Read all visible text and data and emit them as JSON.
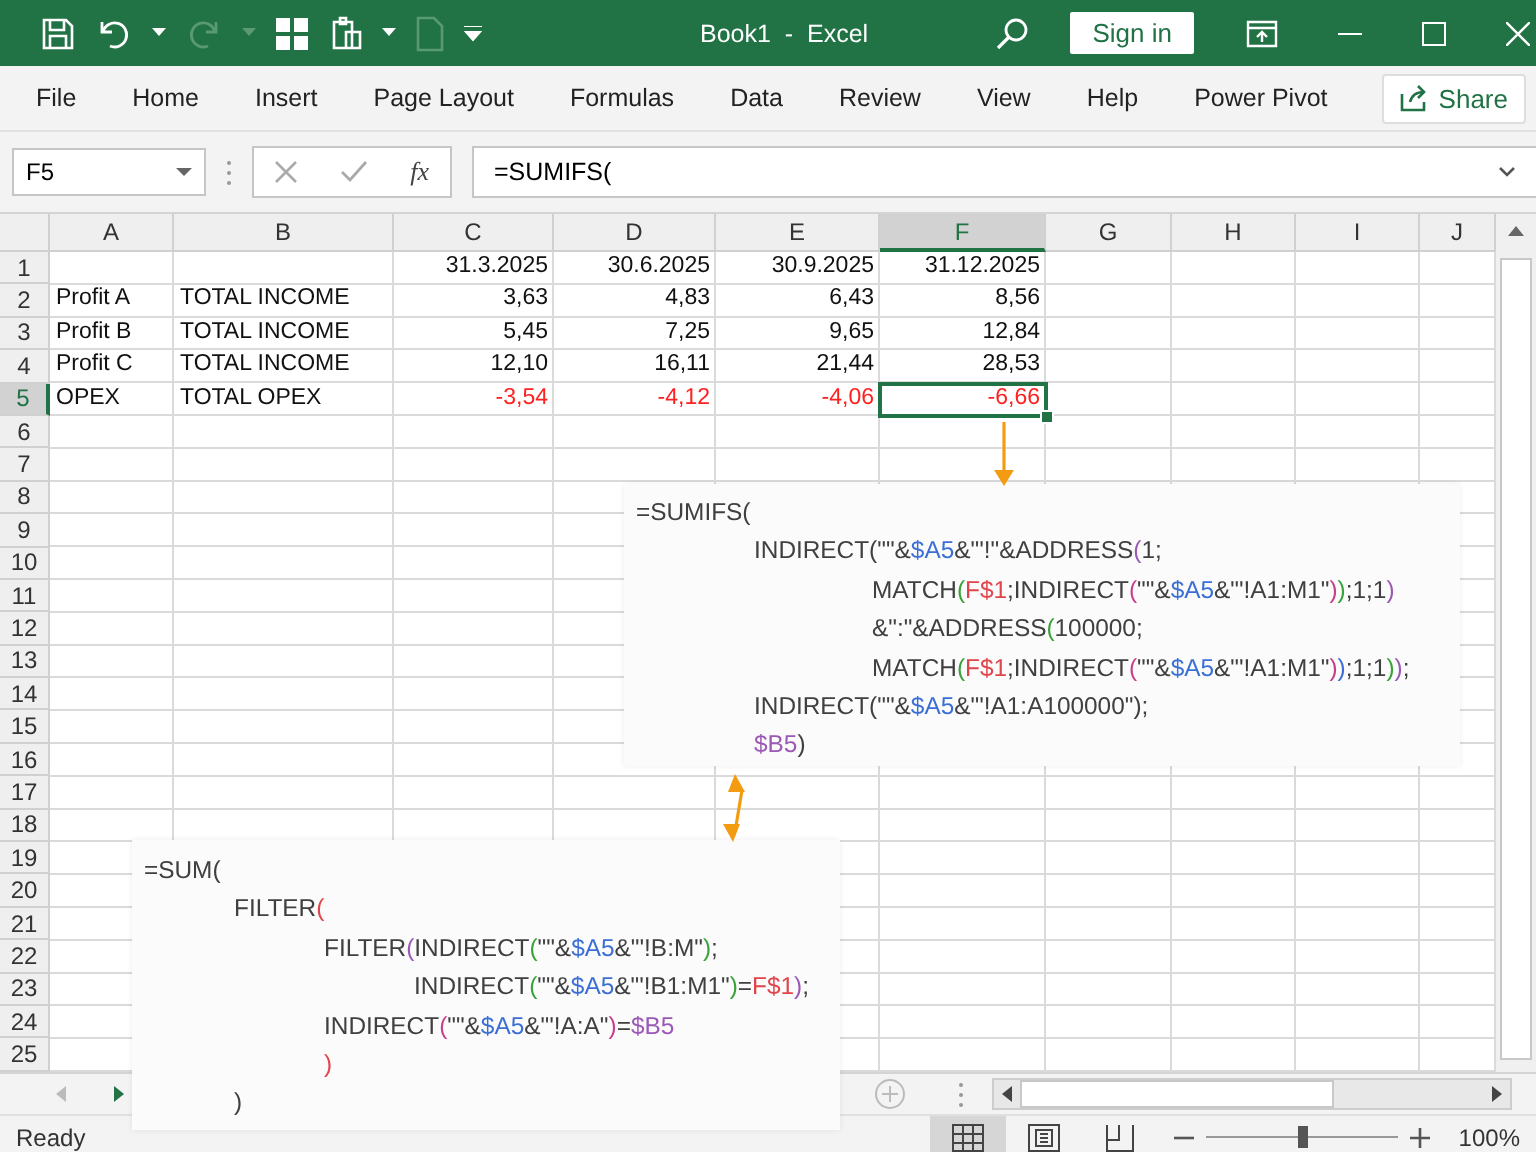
{
  "window": {
    "title": "Book1  -  Excel",
    "sign_in": "Sign in"
  },
  "ribbon": {
    "tabs": [
      "File",
      "Home",
      "Insert",
      "Page Layout",
      "Formulas",
      "Data",
      "Review",
      "View",
      "Help",
      "Power Pivot"
    ],
    "share": "Share"
  },
  "formula_bar": {
    "name_box": "F5",
    "function_label": "fx",
    "formula": "=SUMIFS("
  },
  "columns": [
    {
      "label": "A",
      "selected": false
    },
    {
      "label": "B",
      "selected": false
    },
    {
      "label": "C",
      "selected": false
    },
    {
      "label": "D",
      "selected": false
    },
    {
      "label": "E",
      "selected": false
    },
    {
      "label": "F",
      "selected": true
    },
    {
      "label": "G",
      "selected": false
    },
    {
      "label": "H",
      "selected": false
    },
    {
      "label": "I",
      "selected": false
    },
    {
      "label": "J",
      "selected": false
    }
  ],
  "rows": [
    {
      "number": "1",
      "selected": false,
      "cells": [
        {},
        {},
        {
          "value": "31.3.2025",
          "negative": false,
          "selected": false
        },
        {
          "value": "30.6.2025",
          "negative": false,
          "selected": false
        },
        {
          "value": "30.9.2025",
          "negative": false,
          "selected": false
        },
        {
          "value": "31.12.2025",
          "negative": false,
          "selected": false
        }
      ]
    },
    {
      "number": "2",
      "selected": false,
      "cells": [
        {
          "value": "Profit A",
          "negative": false,
          "selected": false
        },
        {
          "value": "TOTAL INCOME",
          "negative": false,
          "selected": false
        },
        {
          "value": "3,63",
          "negative": false,
          "selected": false
        },
        {
          "value": "4,83",
          "negative": false,
          "selected": false
        },
        {
          "value": "6,43",
          "negative": false,
          "selected": false
        },
        {
          "value": "8,56",
          "negative": false,
          "selected": false
        }
      ]
    },
    {
      "number": "3",
      "selected": false,
      "cells": [
        {
          "value": "Profit B",
          "negative": false,
          "selected": false
        },
        {
          "value": "TOTAL INCOME",
          "negative": false,
          "selected": false
        },
        {
          "value": "5,45",
          "negative": false,
          "selected": false
        },
        {
          "value": "7,25",
          "negative": false,
          "selected": false
        },
        {
          "value": "9,65",
          "negative": false,
          "selected": false
        },
        {
          "value": "12,84",
          "negative": false,
          "selected": false
        }
      ]
    },
    {
      "number": "4",
      "selected": false,
      "cells": [
        {
          "value": "Profit C",
          "negative": false,
          "selected": false
        },
        {
          "value": "TOTAL INCOME",
          "negative": false,
          "selected": false
        },
        {
          "value": "12,10",
          "negative": false,
          "selected": false
        },
        {
          "value": "16,11",
          "negative": false,
          "selected": false
        },
        {
          "value": "21,44",
          "negative": false,
          "selected": false
        },
        {
          "value": "28,53",
          "negative": false,
          "selected": false
        }
      ]
    },
    {
      "number": "5",
      "selected": true,
      "cells": [
        {
          "value": "OPEX",
          "negative": false,
          "selected": false
        },
        {
          "value": "TOTAL OPEX",
          "negative": false,
          "selected": false
        },
        {
          "value": "-3,54",
          "negative": true,
          "selected": false
        },
        {
          "value": "-4,12",
          "negative": true,
          "selected": false
        },
        {
          "value": "-4,06",
          "negative": true,
          "selected": false
        },
        {
          "value": "-6,66",
          "negative": true,
          "selected": true
        }
      ]
    },
    {
      "number": "6",
      "selected": false
    },
    {
      "number": "7",
      "selected": false
    },
    {
      "number": "8",
      "selected": false
    },
    {
      "number": "9",
      "selected": false
    },
    {
      "number": "10",
      "selected": false
    },
    {
      "number": "11",
      "selected": false
    },
    {
      "number": "12",
      "selected": false
    },
    {
      "number": "13",
      "selected": false
    },
    {
      "number": "14",
      "selected": false
    },
    {
      "number": "15",
      "selected": false
    },
    {
      "number": "16",
      "selected": false
    },
    {
      "number": "17",
      "selected": false
    },
    {
      "number": "18",
      "selected": false
    },
    {
      "number": "19",
      "selected": false
    },
    {
      "number": "20",
      "selected": false
    },
    {
      "number": "21",
      "selected": false
    },
    {
      "number": "22",
      "selected": false
    },
    {
      "number": "23",
      "selected": false
    },
    {
      "number": "24",
      "selected": false
    },
    {
      "number": "25",
      "selected": false
    }
  ],
  "callouts": [
    {
      "lines": [
        {
          "segments": [
            {
              "text": "=SUMIFS("
            }
          ],
          "children": [
            {
              "segments": [
                {
                  "text": "INDIRECT("
                },
                {
                  "text": "\"\"&"
                },
                {
                  "text": "$A5",
                  "color": "#3b6fd6"
                },
                {
                  "text": "&\"'!\"&ADDRESS"
                },
                {
                  "text": "(",
                  "color": "#9b59b6"
                },
                {
                  "text": "1;"
                }
              ],
              "children": [
                {
                  "segments": [
                    {
                      "text": "MATCH"
                    },
                    {
                      "text": "(",
                      "color": "#3aa23a"
                    },
                    {
                      "text": "F$1",
                      "color": "#e0454b"
                    },
                    {
                      "text": ";INDIRECT"
                    },
                    {
                      "text": "(",
                      "color": "#c7408a"
                    },
                    {
                      "text": "\"\"&"
                    },
                    {
                      "text": "$A5",
                      "color": "#3b6fd6"
                    },
                    {
                      "text": "&\"'!A1:M1\""
                    },
                    {
                      "text": ")",
                      "color": "#c7408a"
                    },
                    {
                      "text": ")",
                      "color": "#3aa23a"
                    },
                    {
                      "text": ";1;1"
                    },
                    {
                      "text": ")",
                      "color": "#9b59b6"
                    }
                  ]
                },
                {
                  "segments": [
                    {
                      "text": "&\":\"&ADDRESS"
                    },
                    {
                      "text": "(",
                      "color": "#3aa23a"
                    },
                    {
                      "text": "100000;"
                    }
                  ]
                },
                {
                  "segments": [
                    {
                      "text": "MATCH"
                    },
                    {
                      "text": "(",
                      "color": "#3aa23a"
                    },
                    {
                      "text": "F$1",
                      "color": "#e0454b"
                    },
                    {
                      "text": ";INDIRECT"
                    },
                    {
                      "text": "(",
                      "color": "#c7408a"
                    },
                    {
                      "text": "\"\"&"
                    },
                    {
                      "text": "$A5",
                      "color": "#3b6fd6"
                    },
                    {
                      "text": "&\"'!A1:M1\""
                    },
                    {
                      "text": ")",
                      "color": "#c7408a"
                    },
                    {
                      "text": ")",
                      "color": "#3b6fd6"
                    },
                    {
                      "text": ";1;1"
                    },
                    {
                      "text": ")",
                      "color": "#3aa23a"
                    },
                    {
                      "text": ")",
                      "color": "#9b59b6"
                    },
                    {
                      "text": ";"
                    }
                  ]
                }
              ]
            },
            {
              "segments": [
                {
                  "text": "INDIRECT("
                },
                {
                  "text": "\"\"&"
                },
                {
                  "text": "$A5",
                  "color": "#3b6fd6"
                },
                {
                  "text": "&\"'!A1:A100000\""
                },
                {
                  "text": ")"
                },
                {
                  "text": ";"
                }
              ]
            },
            {
              "segments": [
                {
                  "text": "$B5",
                  "color": "#9b59b6"
                },
                {
                  "text": ")"
                }
              ]
            }
          ]
        }
      ]
    },
    {
      "lines": [
        {
          "segments": [
            {
              "text": "=SUM("
            }
          ],
          "children": [
            {
              "segments": [
                {
                  "text": "FILTER"
                },
                {
                  "text": "(",
                  "color": "#e0454b"
                }
              ],
              "children": [
                {
                  "segments": [
                    {
                      "text": "FILTER"
                    },
                    {
                      "text": "(",
                      "color": "#9b59b6"
                    },
                    {
                      "text": "INDIRECT"
                    },
                    {
                      "text": "(",
                      "color": "#3aa23a"
                    },
                    {
                      "text": "\"\"&"
                    },
                    {
                      "text": "$A5",
                      "color": "#3b6fd6"
                    },
                    {
                      "text": "&\"'!B:M\""
                    },
                    {
                      "text": ")",
                      "color": "#3aa23a"
                    },
                    {
                      "text": ";"
                    }
                  ],
                  "children": [
                    {
                      "segments": [
                        {
                          "text": "INDIRECT"
                        },
                        {
                          "text": "(",
                          "color": "#3aa23a"
                        },
                        {
                          "text": "\"\"&"
                        },
                        {
                          "text": "$A5",
                          "color": "#3b6fd6"
                        },
                        {
                          "text": "&\"'!B1:M1\""
                        },
                        {
                          "text": ")",
                          "color": "#3aa23a"
                        },
                        {
                          "text": "="
                        },
                        {
                          "text": "F$1",
                          "color": "#e0454b"
                        },
                        {
                          "text": ")",
                          "color": "#9b59b6"
                        },
                        {
                          "text": ";"
                        }
                      ]
                    }
                  ]
                },
                {
                  "segments": [
                    {
                      "text": "INDIRECT"
                    },
                    {
                      "text": "(",
                      "color": "#c7408a"
                    },
                    {
                      "text": "\"\"&"
                    },
                    {
                      "text": "$A5",
                      "color": "#3b6fd6"
                    },
                    {
                      "text": "&\"'!A:A\""
                    },
                    {
                      "text": ")",
                      "color": "#c7408a"
                    },
                    {
                      "text": "="
                    },
                    {
                      "text": "$B5",
                      "color": "#9b59b6"
                    }
                  ]
                },
                {
                  "segments": [
                    {
                      "text": ")",
                      "color": "#e0454b"
                    }
                  ]
                }
              ]
            },
            {
              "segments": [
                {
                  "text": ")"
                }
              ]
            }
          ]
        }
      ]
    }
  ],
  "status_bar": {
    "status": "Ready",
    "zoom": {
      "level": 0.5,
      "label": "100%"
    }
  }
}
